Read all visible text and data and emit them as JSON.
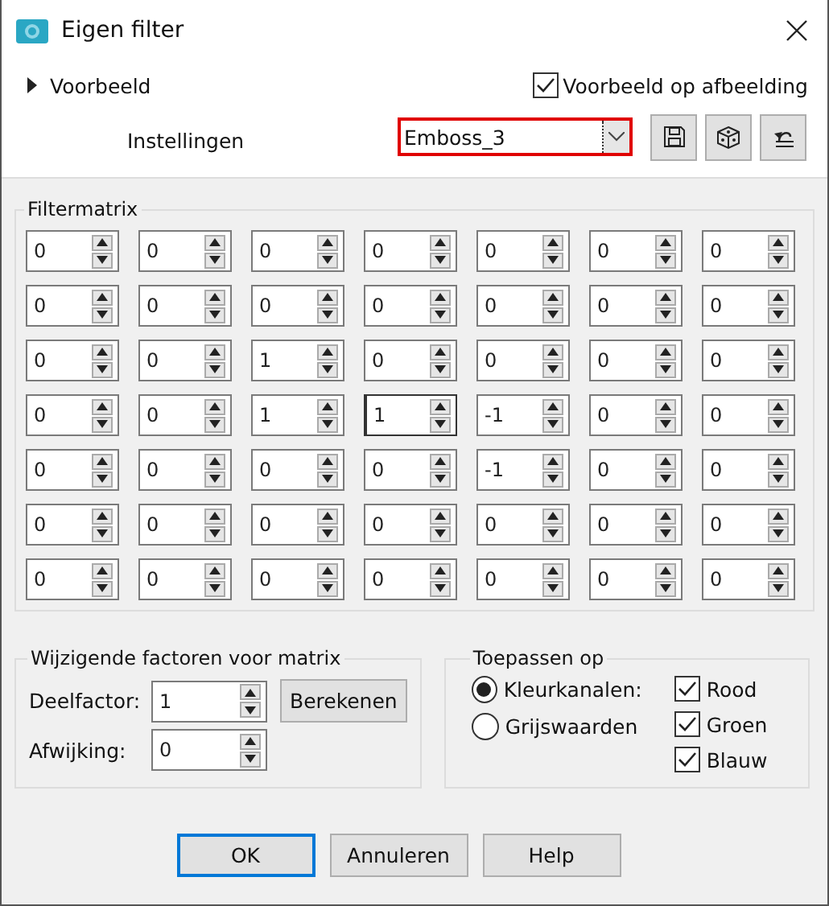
{
  "window": {
    "title": "Eigen filter"
  },
  "preview": {
    "label": "Voorbeeld",
    "expanded": false
  },
  "preview_on_image": {
    "label": "Voorbeeld op afbeelding",
    "checked": true
  },
  "settings": {
    "label": "Instellingen",
    "value": "Emboss_3"
  },
  "matrix": {
    "title": "Filtermatrix",
    "rows": [
      [
        {
          "value": "0",
          "focused": false
        },
        {
          "value": "0",
          "focused": false
        },
        {
          "value": "0",
          "focused": false
        },
        {
          "value": "0",
          "focused": false
        },
        {
          "value": "0",
          "focused": false
        },
        {
          "value": "0",
          "focused": false
        },
        {
          "value": "0",
          "focused": false
        }
      ],
      [
        {
          "value": "0",
          "focused": false
        },
        {
          "value": "0",
          "focused": false
        },
        {
          "value": "0",
          "focused": false
        },
        {
          "value": "0",
          "focused": false
        },
        {
          "value": "0",
          "focused": false
        },
        {
          "value": "0",
          "focused": false
        },
        {
          "value": "0",
          "focused": false
        }
      ],
      [
        {
          "value": "0",
          "focused": false
        },
        {
          "value": "0",
          "focused": false
        },
        {
          "value": "1",
          "focused": false
        },
        {
          "value": "0",
          "focused": false
        },
        {
          "value": "0",
          "focused": false
        },
        {
          "value": "0",
          "focused": false
        },
        {
          "value": "0",
          "focused": false
        }
      ],
      [
        {
          "value": "0",
          "focused": false
        },
        {
          "value": "0",
          "focused": false
        },
        {
          "value": "1",
          "focused": false
        },
        {
          "value": "1",
          "focused": true
        },
        {
          "value": "-1",
          "focused": false
        },
        {
          "value": "0",
          "focused": false
        },
        {
          "value": "0",
          "focused": false
        }
      ],
      [
        {
          "value": "0",
          "focused": false
        },
        {
          "value": "0",
          "focused": false
        },
        {
          "value": "0",
          "focused": false
        },
        {
          "value": "0",
          "focused": false
        },
        {
          "value": "-1",
          "focused": false
        },
        {
          "value": "0",
          "focused": false
        },
        {
          "value": "0",
          "focused": false
        }
      ],
      [
        {
          "value": "0",
          "focused": false
        },
        {
          "value": "0",
          "focused": false
        },
        {
          "value": "0",
          "focused": false
        },
        {
          "value": "0",
          "focused": false
        },
        {
          "value": "0",
          "focused": false
        },
        {
          "value": "0",
          "focused": false
        },
        {
          "value": "0",
          "focused": false
        }
      ],
      [
        {
          "value": "0",
          "focused": false
        },
        {
          "value": "0",
          "focused": false
        },
        {
          "value": "0",
          "focused": false
        },
        {
          "value": "0",
          "focused": false
        },
        {
          "value": "0",
          "focused": false
        },
        {
          "value": "0",
          "focused": false
        },
        {
          "value": "0",
          "focused": false
        }
      ]
    ]
  },
  "modifiers": {
    "title": "Wijzigende factoren voor matrix",
    "divisor": {
      "label": "Deelfactor:",
      "value": "1"
    },
    "calculate": "Berekenen",
    "bias": {
      "label": "Afwijking:",
      "value": "0"
    }
  },
  "apply_to": {
    "title": "Toepassen op",
    "modes": [
      {
        "label": "Kleurkanalen:",
        "selected": true
      },
      {
        "label": "Grijswaarden",
        "selected": false
      }
    ],
    "channels": [
      {
        "label": "Rood",
        "checked": true
      },
      {
        "label": "Groen",
        "checked": true
      },
      {
        "label": "Blauw",
        "checked": true
      }
    ]
  },
  "buttons": [
    {
      "label": "OK",
      "default": true
    },
    {
      "label": "Annuleren",
      "default": false
    },
    {
      "label": "Help",
      "default": false
    }
  ]
}
